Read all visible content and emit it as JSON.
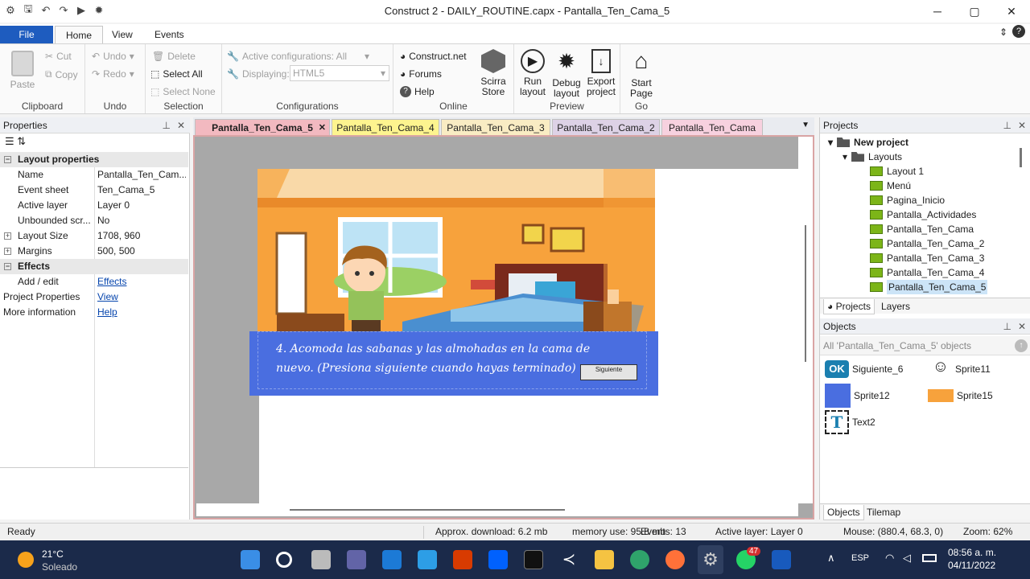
{
  "window": {
    "title": "Construct 2 - DAILY_ROUTINE.capx - Pantalla_Ten_Cama_5",
    "min": "─",
    "max": "▢",
    "close": "✕"
  },
  "ribbon_tabs": {
    "file": "File",
    "home": "Home",
    "view": "View",
    "events": "Events"
  },
  "ribbon": {
    "clipboard": {
      "paste": "Paste",
      "cut": "Cut",
      "copy": "Copy",
      "label": "Clipboard"
    },
    "undo": {
      "undo": "Undo",
      "redo": "Redo",
      "label": "Undo"
    },
    "selection": {
      "delete": "Delete",
      "select_all": "Select All",
      "select_none": "Select None",
      "label": "Selection"
    },
    "configurations": {
      "active": "Active configurations: All",
      "displaying_label": "Displaying:",
      "displaying_value": "HTML5",
      "label": "Configurations"
    },
    "online": {
      "construct": "Construct.net",
      "forums": "Forums",
      "help": "Help",
      "store_line1": "Scirra",
      "store_line2": "Store",
      "label": "Online"
    },
    "preview": {
      "run1": "Run",
      "run2": "layout",
      "debug1": "Debug",
      "debug2": "layout",
      "export1": "Export",
      "export2": "project",
      "label": "Preview"
    },
    "go": {
      "start1": "Start",
      "start2": "Page",
      "label": "Go"
    }
  },
  "properties": {
    "title": "Properties",
    "pin": "⊥",
    "close": "✕",
    "sections": {
      "layout": "Layout properties",
      "effects": "Effects"
    },
    "rows": [
      {
        "k": "Name",
        "v": "Pantalla_Ten_Cam..."
      },
      {
        "k": "Event sheet",
        "v": "Ten_Cama_5"
      },
      {
        "k": "Active layer",
        "v": "Layer 0"
      },
      {
        "k": "Unbounded scr...",
        "v": "No"
      },
      {
        "k": "Layout Size",
        "v": "1708, 960"
      },
      {
        "k": "Margins",
        "v": "500, 500"
      }
    ],
    "effects_row": {
      "k": "Add / edit",
      "v": "Effects"
    },
    "project_row": {
      "k": "Project Properties",
      "v": "View"
    },
    "more_row": {
      "k": "More information",
      "v": "Help"
    }
  },
  "doc_tabs": [
    "Pantalla_Ten_Cama_5",
    "Pantalla_Ten_Cama_4",
    "Pantalla_Ten_Cama_3",
    "Pantalla_Ten_Cama_2",
    "Pantalla_Ten_Cama"
  ],
  "doc_tab_close": "✕",
  "doc_tab_menu": "▼",
  "canvas": {
    "text": "4. Acomoda las sabanas y las almohadas en la cama de nuevo. (Presiona siguiente cuando hayas terminado)",
    "button": "Siguiente"
  },
  "projects": {
    "title": "Projects",
    "root": "New project",
    "layouts_folder": "Layouts",
    "layouts": [
      "Layout 1",
      "Menú",
      "Pagina_Inicio",
      "Pantalla_Actividades",
      "Pantalla_Ten_Cama",
      "Pantalla_Ten_Cama_2",
      "Pantalla_Ten_Cama_3",
      "Pantalla_Ten_Cama_4",
      "Pantalla_Ten_Cama_5"
    ],
    "tab_projects": "Projects",
    "tab_layers": "Layers"
  },
  "objects": {
    "title": "Objects",
    "filter": "All 'Pantalla_Ten_Cama_5' objects",
    "items": [
      "Siguiente_6",
      "Sprite11",
      "Sprite12",
      "Sprite15",
      "Text2"
    ],
    "ok_badge": "OK",
    "text_badge": "T",
    "tab_objects": "Objects",
    "tab_tilemap": "Tilemap"
  },
  "status": {
    "ready": "Ready",
    "download": "Approx. download: 6.2 mb",
    "memory": "memory use: 95.8 mb",
    "events": "Events: 13",
    "layer": "Active layer: Layer 0",
    "mouse": "Mouse: (880.4, 68.3, 0)",
    "zoom": "Zoom: 62%"
  },
  "taskbar": {
    "temp": "21°C",
    "weather": "Soleado",
    "lang": "ESP",
    "time": "08:56 a. m.",
    "date": "04/11/2022",
    "badge": "47"
  }
}
